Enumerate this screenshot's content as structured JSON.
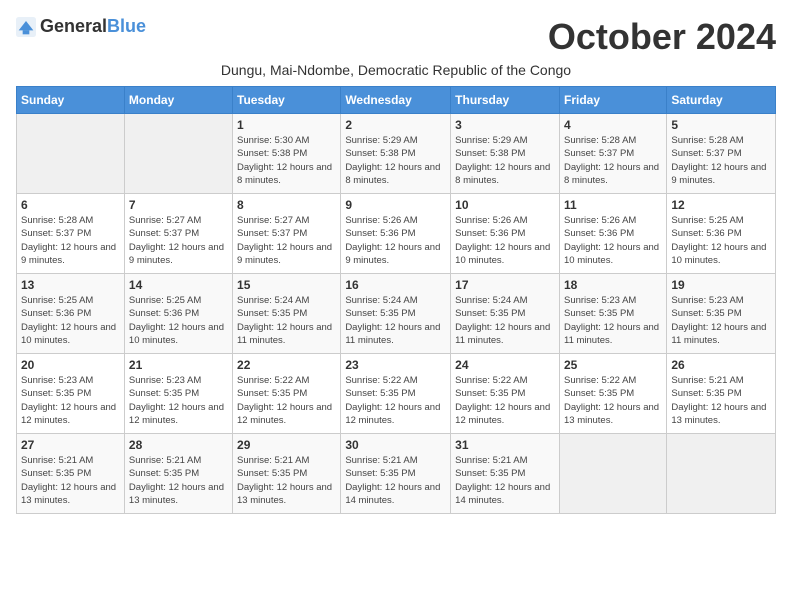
{
  "logo": {
    "general": "General",
    "blue": "Blue"
  },
  "title": "October 2024",
  "subtitle": "Dungu, Mai-Ndombe, Democratic Republic of the Congo",
  "days_of_week": [
    "Sunday",
    "Monday",
    "Tuesday",
    "Wednesday",
    "Thursday",
    "Friday",
    "Saturday"
  ],
  "weeks": [
    [
      {
        "day": "",
        "sunrise": "",
        "sunset": "",
        "daylight": ""
      },
      {
        "day": "",
        "sunrise": "",
        "sunset": "",
        "daylight": ""
      },
      {
        "day": "1",
        "sunrise": "Sunrise: 5:30 AM",
        "sunset": "Sunset: 5:38 PM",
        "daylight": "Daylight: 12 hours and 8 minutes."
      },
      {
        "day": "2",
        "sunrise": "Sunrise: 5:29 AM",
        "sunset": "Sunset: 5:38 PM",
        "daylight": "Daylight: 12 hours and 8 minutes."
      },
      {
        "day": "3",
        "sunrise": "Sunrise: 5:29 AM",
        "sunset": "Sunset: 5:38 PM",
        "daylight": "Daylight: 12 hours and 8 minutes."
      },
      {
        "day": "4",
        "sunrise": "Sunrise: 5:28 AM",
        "sunset": "Sunset: 5:37 PM",
        "daylight": "Daylight: 12 hours and 8 minutes."
      },
      {
        "day": "5",
        "sunrise": "Sunrise: 5:28 AM",
        "sunset": "Sunset: 5:37 PM",
        "daylight": "Daylight: 12 hours and 9 minutes."
      }
    ],
    [
      {
        "day": "6",
        "sunrise": "Sunrise: 5:28 AM",
        "sunset": "Sunset: 5:37 PM",
        "daylight": "Daylight: 12 hours and 9 minutes."
      },
      {
        "day": "7",
        "sunrise": "Sunrise: 5:27 AM",
        "sunset": "Sunset: 5:37 PM",
        "daylight": "Daylight: 12 hours and 9 minutes."
      },
      {
        "day": "8",
        "sunrise": "Sunrise: 5:27 AM",
        "sunset": "Sunset: 5:37 PM",
        "daylight": "Daylight: 12 hours and 9 minutes."
      },
      {
        "day": "9",
        "sunrise": "Sunrise: 5:26 AM",
        "sunset": "Sunset: 5:36 PM",
        "daylight": "Daylight: 12 hours and 9 minutes."
      },
      {
        "day": "10",
        "sunrise": "Sunrise: 5:26 AM",
        "sunset": "Sunset: 5:36 PM",
        "daylight": "Daylight: 12 hours and 10 minutes."
      },
      {
        "day": "11",
        "sunrise": "Sunrise: 5:26 AM",
        "sunset": "Sunset: 5:36 PM",
        "daylight": "Daylight: 12 hours and 10 minutes."
      },
      {
        "day": "12",
        "sunrise": "Sunrise: 5:25 AM",
        "sunset": "Sunset: 5:36 PM",
        "daylight": "Daylight: 12 hours and 10 minutes."
      }
    ],
    [
      {
        "day": "13",
        "sunrise": "Sunrise: 5:25 AM",
        "sunset": "Sunset: 5:36 PM",
        "daylight": "Daylight: 12 hours and 10 minutes."
      },
      {
        "day": "14",
        "sunrise": "Sunrise: 5:25 AM",
        "sunset": "Sunset: 5:36 PM",
        "daylight": "Daylight: 12 hours and 10 minutes."
      },
      {
        "day": "15",
        "sunrise": "Sunrise: 5:24 AM",
        "sunset": "Sunset: 5:35 PM",
        "daylight": "Daylight: 12 hours and 11 minutes."
      },
      {
        "day": "16",
        "sunrise": "Sunrise: 5:24 AM",
        "sunset": "Sunset: 5:35 PM",
        "daylight": "Daylight: 12 hours and 11 minutes."
      },
      {
        "day": "17",
        "sunrise": "Sunrise: 5:24 AM",
        "sunset": "Sunset: 5:35 PM",
        "daylight": "Daylight: 12 hours and 11 minutes."
      },
      {
        "day": "18",
        "sunrise": "Sunrise: 5:23 AM",
        "sunset": "Sunset: 5:35 PM",
        "daylight": "Daylight: 12 hours and 11 minutes."
      },
      {
        "day": "19",
        "sunrise": "Sunrise: 5:23 AM",
        "sunset": "Sunset: 5:35 PM",
        "daylight": "Daylight: 12 hours and 11 minutes."
      }
    ],
    [
      {
        "day": "20",
        "sunrise": "Sunrise: 5:23 AM",
        "sunset": "Sunset: 5:35 PM",
        "daylight": "Daylight: 12 hours and 12 minutes."
      },
      {
        "day": "21",
        "sunrise": "Sunrise: 5:23 AM",
        "sunset": "Sunset: 5:35 PM",
        "daylight": "Daylight: 12 hours and 12 minutes."
      },
      {
        "day": "22",
        "sunrise": "Sunrise: 5:22 AM",
        "sunset": "Sunset: 5:35 PM",
        "daylight": "Daylight: 12 hours and 12 minutes."
      },
      {
        "day": "23",
        "sunrise": "Sunrise: 5:22 AM",
        "sunset": "Sunset: 5:35 PM",
        "daylight": "Daylight: 12 hours and 12 minutes."
      },
      {
        "day": "24",
        "sunrise": "Sunrise: 5:22 AM",
        "sunset": "Sunset: 5:35 PM",
        "daylight": "Daylight: 12 hours and 12 minutes."
      },
      {
        "day": "25",
        "sunrise": "Sunrise: 5:22 AM",
        "sunset": "Sunset: 5:35 PM",
        "daylight": "Daylight: 12 hours and 13 minutes."
      },
      {
        "day": "26",
        "sunrise": "Sunrise: 5:21 AM",
        "sunset": "Sunset: 5:35 PM",
        "daylight": "Daylight: 12 hours and 13 minutes."
      }
    ],
    [
      {
        "day": "27",
        "sunrise": "Sunrise: 5:21 AM",
        "sunset": "Sunset: 5:35 PM",
        "daylight": "Daylight: 12 hours and 13 minutes."
      },
      {
        "day": "28",
        "sunrise": "Sunrise: 5:21 AM",
        "sunset": "Sunset: 5:35 PM",
        "daylight": "Daylight: 12 hours and 13 minutes."
      },
      {
        "day": "29",
        "sunrise": "Sunrise: 5:21 AM",
        "sunset": "Sunset: 5:35 PM",
        "daylight": "Daylight: 12 hours and 13 minutes."
      },
      {
        "day": "30",
        "sunrise": "Sunrise: 5:21 AM",
        "sunset": "Sunset: 5:35 PM",
        "daylight": "Daylight: 12 hours and 14 minutes."
      },
      {
        "day": "31",
        "sunrise": "Sunrise: 5:21 AM",
        "sunset": "Sunset: 5:35 PM",
        "daylight": "Daylight: 12 hours and 14 minutes."
      },
      {
        "day": "",
        "sunrise": "",
        "sunset": "",
        "daylight": ""
      },
      {
        "day": "",
        "sunrise": "",
        "sunset": "",
        "daylight": ""
      }
    ]
  ]
}
